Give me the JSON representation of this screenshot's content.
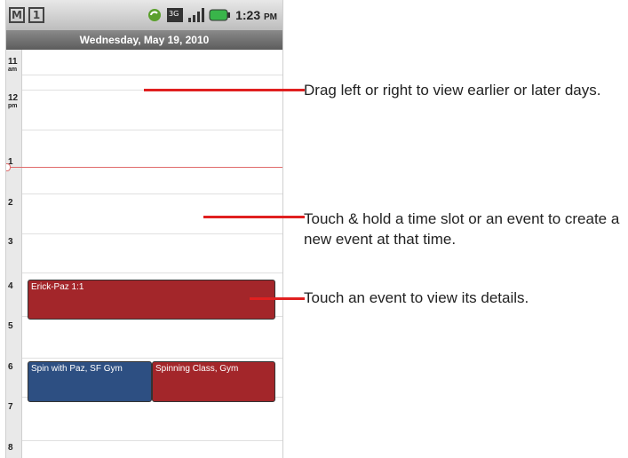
{
  "status_bar": {
    "left_icons": [
      "gmail-icon",
      "calendar-notification-icon"
    ],
    "right_icons": [
      "sync-icon",
      "3g-icon",
      "signal-icon",
      "battery-icon"
    ],
    "time": "1:23",
    "ampm": "PM"
  },
  "day_header": "Wednesday, May 19, 2010",
  "hours": [
    {
      "num": "11",
      "ampm": "am"
    },
    {
      "num": "12",
      "ampm": "pm"
    },
    {
      "num": "1",
      "ampm": ""
    },
    {
      "num": "2",
      "ampm": ""
    },
    {
      "num": "3",
      "ampm": ""
    },
    {
      "num": "4",
      "ampm": ""
    },
    {
      "num": "5",
      "ampm": ""
    },
    {
      "num": "6",
      "ampm": ""
    },
    {
      "num": "7",
      "ampm": ""
    },
    {
      "num": "8",
      "ampm": ""
    }
  ],
  "events": [
    {
      "title": "Erick-Paz 1:1",
      "color": "#a3262a"
    },
    {
      "title": "Spin with Paz, SF Gym",
      "color": "#2d4f82"
    },
    {
      "title": "Spinning Class, Gym",
      "color": "#a3262a"
    }
  ],
  "callouts": [
    {
      "text": "Drag left or right to view earlier or later days."
    },
    {
      "text": "Touch & hold a time slot or an event to create a new event at that time."
    },
    {
      "text": "Touch an event to view its details."
    }
  ],
  "colors": {
    "accent_line": "#e02020",
    "now_line": "#e06a6a"
  }
}
